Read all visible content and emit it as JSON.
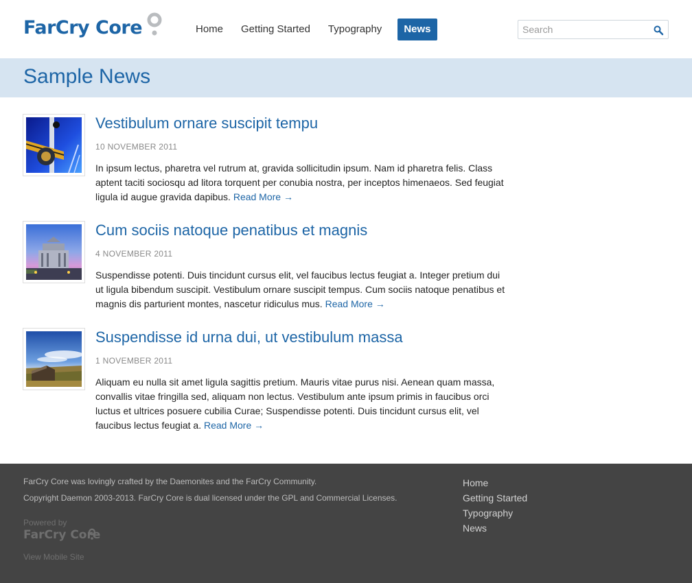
{
  "brand": {
    "name": "FarCry Core"
  },
  "nav": {
    "items": [
      {
        "label": "Home"
      },
      {
        "label": "Getting Started"
      },
      {
        "label": "Typography"
      },
      {
        "label": "News"
      }
    ],
    "active": "News"
  },
  "search": {
    "placeholder": "Search",
    "value": ""
  },
  "page": {
    "title": "Sample News"
  },
  "articles": [
    {
      "title": "Vestibulum ornare suscipit tempu",
      "date": "10 NOVEMBER 2011",
      "body": "In ipsum lectus, pharetra vel rutrum at, gravida sollicitudin ipsum. Nam id pharetra felis. Class aptent taciti sociosqu ad litora torquent per conubia nostra, per inceptos himenaeos. Sed feugiat ligula id augue gravida dapibus.",
      "read_more": "Read More →",
      "thumb_icon": "abstract-blue-photo"
    },
    {
      "title": "Cum sociis natoque penatibus et magnis",
      "date": "4 NOVEMBER 2011",
      "body": "Suspendisse potenti. Duis tincidunt cursus elit, vel faucibus lectus feugiat a. Integer pretium dui ut ligula bibendum suscipit. Vestibulum ornare suscipit tempus. Cum sociis natoque penatibus et magnis dis parturient montes, nascetur ridiculus mus.",
      "read_more": "Read More →",
      "thumb_icon": "monument-dusk-photo"
    },
    {
      "title": "Suspendisse id urna dui, ut vestibulum massa",
      "date": "1 NOVEMBER 2011",
      "body": "Aliquam eu nulla sit amet ligula sagittis pretium. Mauris vitae purus nisi. Aenean quam massa, convallis vitae fringilla sed, aliquam non lectus. Vestibulum ante ipsum primis in faucibus orci luctus et ultrices posuere cubilia Curae; Suspendisse potenti. Duis tincidunt cursus elit, vel faucibus lectus feugiat a.",
      "read_more": "Read More →",
      "thumb_icon": "field-sky-photo"
    }
  ],
  "footer": {
    "credit": "FarCry Core was lovingly crafted by the Daemonites and the FarCry Community.",
    "copyright": "Copyright Daemon 2003-2013. FarCry Core is dual licensed under the GPL and Commercial Licenses.",
    "powered_by": "Powered by",
    "logo": "FarCry Core",
    "mobile_link": "View Mobile Site",
    "nav": [
      {
        "label": "Home"
      },
      {
        "label": "Getting Started"
      },
      {
        "label": "Typography"
      },
      {
        "label": "News"
      }
    ]
  },
  "colors": {
    "brand_blue": "#1d65a6",
    "title_band": "#d6e4f1",
    "footer_bg": "#444444"
  }
}
